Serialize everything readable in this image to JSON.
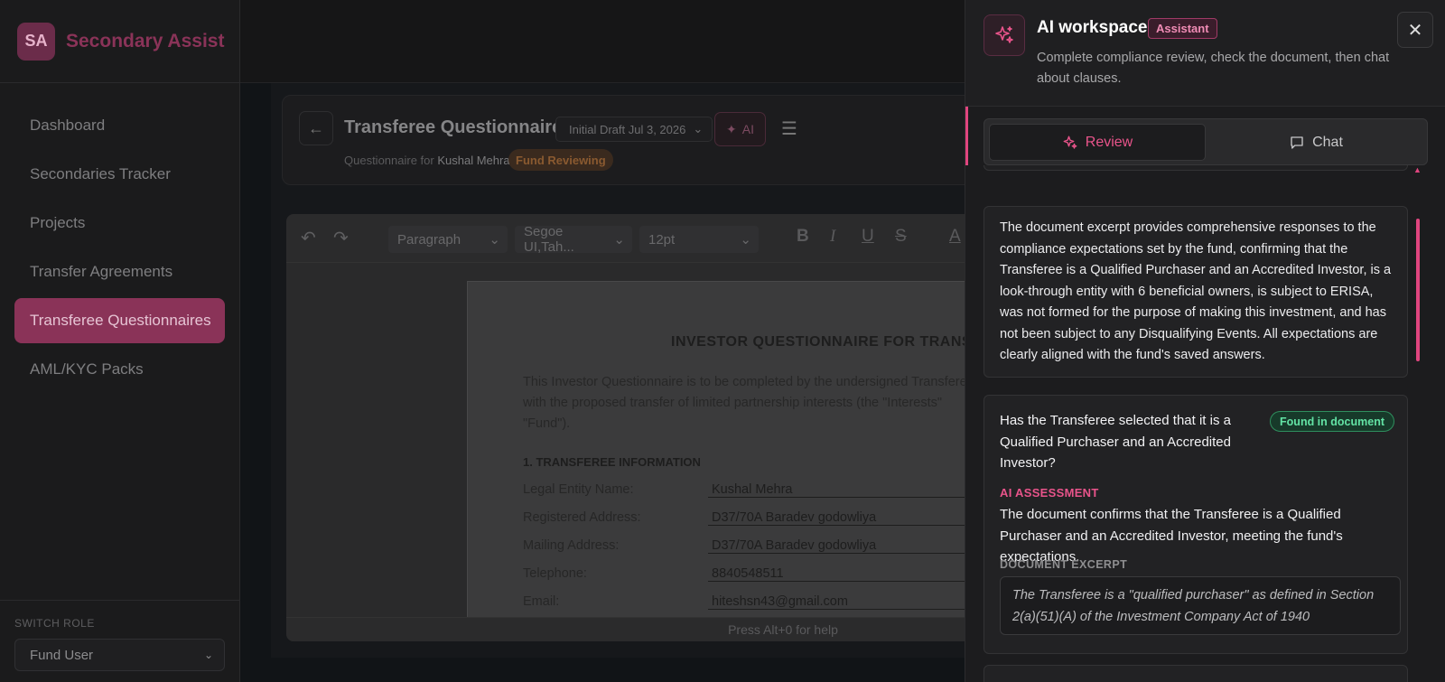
{
  "brand": {
    "initials": "SA",
    "name": "Secondary Assist"
  },
  "nav": [
    {
      "label": "Dashboard",
      "active": false
    },
    {
      "label": "Secondaries Tracker",
      "active": false
    },
    {
      "label": "Projects",
      "active": false
    },
    {
      "label": "Transfer Agreements",
      "active": false
    },
    {
      "label": "Transferee Questionnaires",
      "active": true
    },
    {
      "label": "AML/KYC Packs",
      "active": false
    }
  ],
  "role": {
    "label": "SWITCH ROLE",
    "value": "Fund User"
  },
  "doc": {
    "title": "Transferee Questionnaire",
    "draft": "Initial Draft Jul 3, 2026",
    "ai_label": "AI",
    "subtitle_prefix": "Questionnaire for",
    "subtitle_name": "Kushal Mehra",
    "status": "Fund Reviewing"
  },
  "editor": {
    "block": "Paragraph",
    "font": "Segoe UI,Tah...",
    "size": "12pt",
    "help": "Press Alt+0 for help",
    "page": {
      "title": "INVESTOR QUESTIONNAIRE FOR TRANS",
      "intro": "This Investor Questionnaire is to be completed by the undersigned Transfere with the proposed transfer of limited partnership interests (the \"Interests\" \"Fund\").",
      "section": "1. TRANSFEREE INFORMATION",
      "rows": [
        {
          "label": "Legal Entity Name:",
          "value": "Kushal Mehra"
        },
        {
          "label": "Registered Address:",
          "value": "D37/70A Baradev godowliya"
        },
        {
          "label": "Mailing Address:",
          "value": "D37/70A Baradev godowliya"
        },
        {
          "label": "Telephone:",
          "value": "8840548511"
        },
        {
          "label": "Email:",
          "value": "hiteshsn43@gmail.com"
        }
      ]
    }
  },
  "panel": {
    "title": "AI workspace",
    "badge": "Assistant",
    "subtitle": "Complete compliance review, check the document, then chat about clauses.",
    "tabs": {
      "review": "Review",
      "chat": "Chat"
    },
    "summary": "The document excerpt provides comprehensive responses to the compliance expectations set by the fund, confirming that the Transferee is a Qualified Purchaser and an Accredited Investor, is a look-through entity with 6 beneficial owners, is subject to ERISA, was not formed for the purpose of making this investment, and has not been subject to any Disqualifying Events. All expectations are clearly aligned with the fund's saved answers.",
    "item": {
      "question": "Has the Transferee selected that it is a Qualified Purchaser and an Accredited Investor?",
      "status": "Found in document",
      "ai_label": "AI ASSESSMENT",
      "assessment": "The document confirms that the Transferee is a Qualified Purchaser and an Accredited Investor, meeting the fund's expectations.",
      "excerpt_label": "DOCUMENT EXCERPT",
      "excerpt": "The Transferee is a \"qualified purchaser\" as defined in Section 2(a)(51)(A) of the Investment Company Act of 1940"
    }
  },
  "colors": {
    "accent": "#e0457f",
    "found": "#63e3a5",
    "brand": "#8a3358"
  }
}
